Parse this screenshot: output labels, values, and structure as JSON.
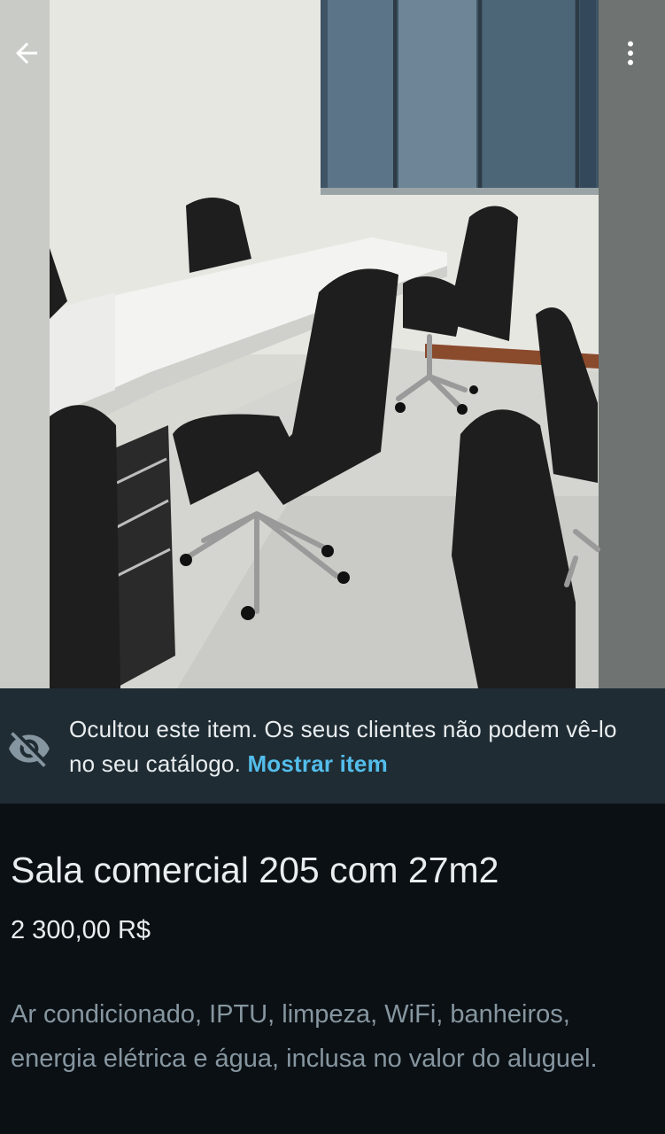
{
  "header": {
    "back_icon": "arrow-left-icon",
    "menu_icon": "more-vertical-icon"
  },
  "photo": {
    "description_icon": "product-photo"
  },
  "notice": {
    "icon": "eye-off-icon",
    "text": "Ocultou este item. Os seus clientes não podem vê-lo no seu catálogo.",
    "link_label": "Mostrar item",
    "link_color": "#53bdeb"
  },
  "product": {
    "title": "Sala comercial 205 com 27m2",
    "price": "2 300,00 R$",
    "description": "Ar condicionado, IPTU, limpeza, WiFi, banheiros, energia elétrica e água, inclusa no valor do aluguel."
  },
  "colors": {
    "background": "#0b1014",
    "notice_background": "#1f2c33",
    "primary_text": "#e9edef",
    "secondary_text": "#8696a0"
  }
}
